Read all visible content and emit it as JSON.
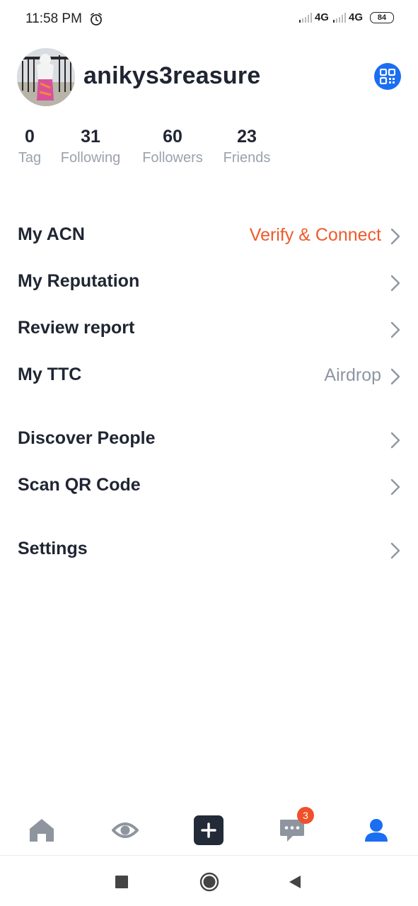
{
  "status_bar": {
    "time": "11:58 PM",
    "network1": "4G",
    "network2": "4G",
    "battery": "84"
  },
  "profile": {
    "username": "anikys3reasure"
  },
  "stats": [
    {
      "value": "0",
      "label": "Tag"
    },
    {
      "value": "31",
      "label": "Following"
    },
    {
      "value": "60",
      "label": "Followers"
    },
    {
      "value": "23",
      "label": "Friends"
    }
  ],
  "menu": {
    "acn": {
      "label": "My ACN",
      "value": "Verify & Connect"
    },
    "reputation": {
      "label": "My Reputation"
    },
    "review": {
      "label": "Review report"
    },
    "ttc": {
      "label": "My TTC",
      "value": "Airdrop"
    },
    "discover": {
      "label": "Discover People"
    },
    "scan": {
      "label": "Scan QR Code"
    },
    "settings": {
      "label": "Settings"
    }
  },
  "tabs": {
    "messages_badge": "3"
  },
  "colors": {
    "accent_blue": "#1a6ef2",
    "accent_orange": "#ef5a2a",
    "tab_gray": "#8e959f",
    "dark": "#1f2532"
  },
  "icons": {
    "tabs": [
      "home-icon",
      "eye-icon",
      "plus-icon",
      "chat-icon",
      "profile-icon"
    ],
    "nav": [
      "square-icon",
      "circle-icon",
      "back-triangle-icon"
    ]
  }
}
